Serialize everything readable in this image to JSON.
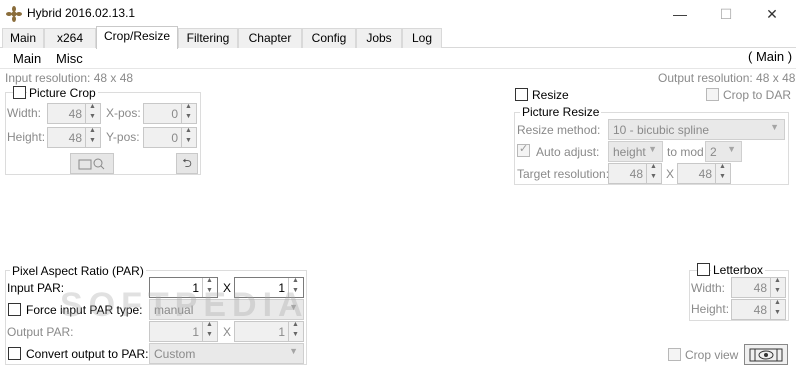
{
  "window": {
    "title": "Hybrid 2016.02.13.1",
    "minimize": "—",
    "maximize": "☐",
    "close": "✕"
  },
  "tabs": [
    "Main",
    "x264",
    "Crop/Resize",
    "Filtering",
    "Chapter",
    "Config",
    "Jobs",
    "Log"
  ],
  "subtabs": [
    "Main",
    "Misc"
  ],
  "section_label": "( Main )",
  "input_resolution": "Input resolution: 48 x 48",
  "output_resolution": "Output resolution: 48 x 48",
  "picture_crop": {
    "title": "Picture Crop",
    "width_label": "Width:",
    "width": "48",
    "height_label": "Height:",
    "height": "48",
    "xpos_label": "X-pos:",
    "xpos": "0",
    "ypos_label": "Y-pos:",
    "ypos": "0"
  },
  "resize": {
    "label": "Resize",
    "crop_to_dar": "Crop to DAR"
  },
  "picture_resize": {
    "title": "Picture Resize",
    "method_label": "Resize method:",
    "method": "10 - bicubic spline",
    "auto_adjust": "Auto adjust:",
    "adjust_value": "height",
    "to_mod": "to mod",
    "mod_value": "2",
    "target_label": "Target resolution:",
    "target_w": "48",
    "x": "X",
    "target_h": "48"
  },
  "par": {
    "title": "Pixel Aspect Ratio (PAR)",
    "input_label": "Input PAR:",
    "input_a": "1",
    "input_b": "1",
    "x": "X",
    "force_label": "Force input PAR type:",
    "force_value": "manual",
    "output_label": "Output PAR:",
    "output_a": "1",
    "output_b": "1",
    "convert_label": "Convert output to PAR:",
    "convert_value": "Custom"
  },
  "letterbox": {
    "label": "Letterbox",
    "width_label": "Width:",
    "width": "48",
    "height_label": "Height:",
    "height": "48"
  },
  "crop_view": "Crop view",
  "watermark": "SOFTPEDIA"
}
